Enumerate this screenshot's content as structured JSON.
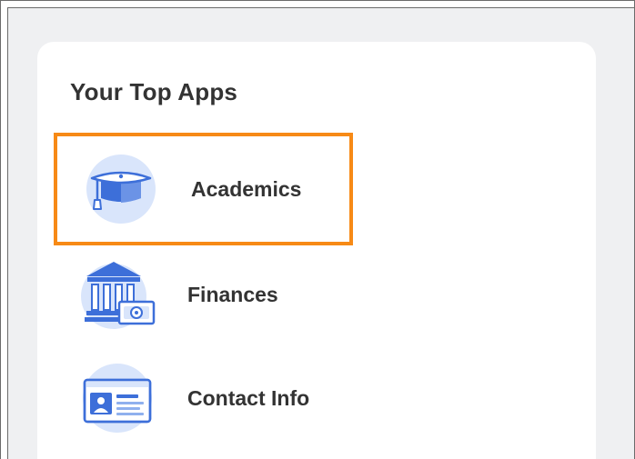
{
  "widget": {
    "title": "Your Top Apps",
    "apps": [
      {
        "label": "Academics",
        "icon": "graduation-cap-icon",
        "selected": true
      },
      {
        "label": "Finances",
        "icon": "bank-money-icon",
        "selected": false
      },
      {
        "label": "Contact Info",
        "icon": "id-card-icon",
        "selected": false
      }
    ]
  },
  "colors": {
    "highlight": "#f78a16",
    "icon_primary": "#3d6fd9",
    "icon_light": "#d9e5fb",
    "page_background": "#eff0f2",
    "card_background": "#ffffff",
    "text": "#333333"
  }
}
